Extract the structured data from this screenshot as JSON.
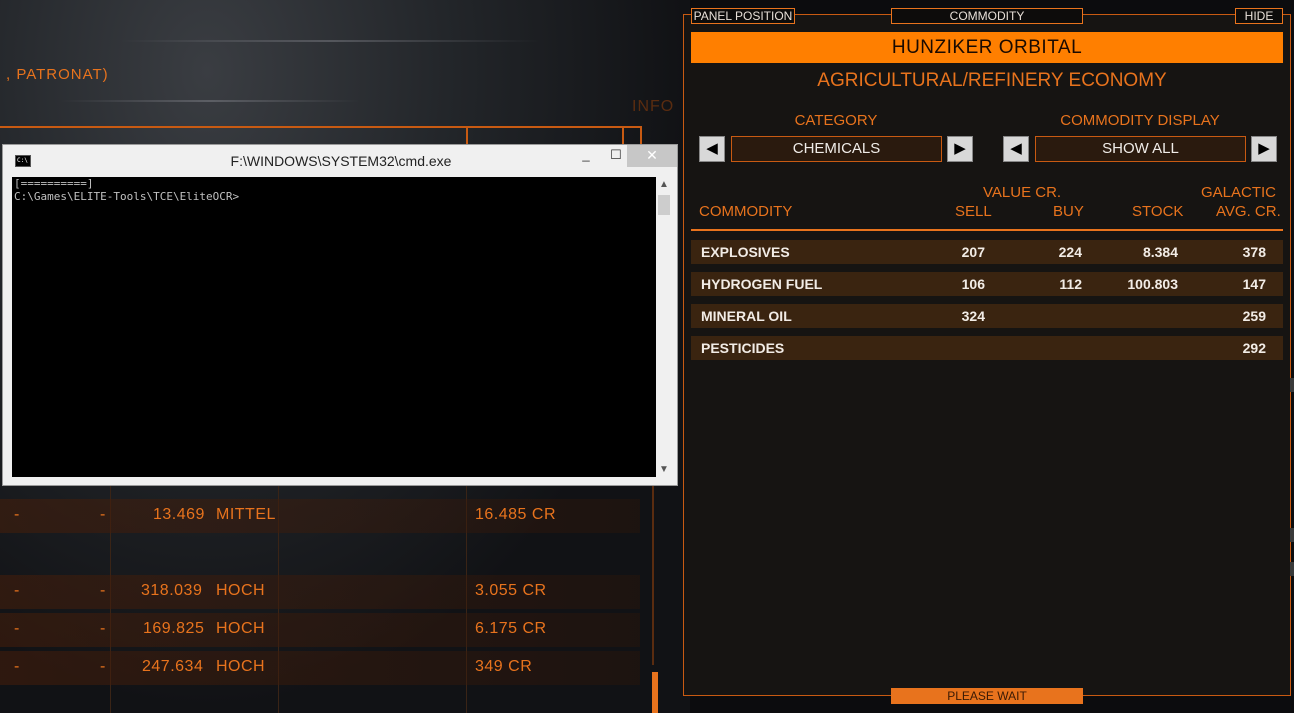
{
  "game_background": {
    "faction_fragment": ", PATRONAT)",
    "info_fragment": "INFO",
    "rows": [
      {
        "c1": "-",
        "c2": "-",
        "supply": "13.469",
        "level": "MITTEL",
        "price": "16.485 CR"
      },
      {
        "c1": "-",
        "c2": "-",
        "supply": "318.039",
        "level": "HOCH",
        "price": "3.055 CR"
      },
      {
        "c1": "-",
        "c2": "-",
        "supply": "169.825",
        "level": "HOCH",
        "price": "6.175 CR"
      },
      {
        "c1": "-",
        "c2": "-",
        "supply": "247.634",
        "level": "HOCH",
        "price": "349 CR"
      }
    ]
  },
  "console": {
    "title": "F:\\WINDOWS\\SYSTEM32\\cmd.exe",
    "icon_label": "C:\\",
    "minimize": "_",
    "maximize": "☐",
    "close": "✕",
    "line1": "[==========]",
    "line2": "C:\\Games\\ELITE-Tools\\TCE\\EliteOCR>"
  },
  "panel": {
    "panel_position_tab": "PANEL POSITION",
    "commodity_tab": "COMMODITY",
    "hide_tab": "HIDE",
    "status": "PLEASE WAIT",
    "station_name": "HUNZIKER ORBITAL",
    "economy": "AGRICULTURAL/REFINERY ECONOMY",
    "category_label": "CATEGORY",
    "category_value": "CHEMICALS",
    "display_label": "COMMODITY DISPLAY",
    "display_value": "SHOW ALL",
    "prev_icon": "◀",
    "next_icon": "▶",
    "headers": {
      "commodity": "COMMODITY",
      "value_cr": "VALUE CR.",
      "sell": "SELL",
      "buy": "BUY",
      "stock": "STOCK",
      "galactic": "GALACTIC",
      "avg_cr": "AVG. CR."
    },
    "rows": [
      {
        "name": "EXPLOSIVES",
        "sell": "207",
        "buy": "224",
        "stock": "8.384",
        "avg": "378"
      },
      {
        "name": "HYDROGEN FUEL",
        "sell": "106",
        "buy": "112",
        "stock": "100.803",
        "avg": "147"
      },
      {
        "name": "MINERAL OIL",
        "sell": "324",
        "buy": "",
        "stock": "",
        "avg": "259"
      },
      {
        "name": "PESTICIDES",
        "sell": "",
        "buy": "",
        "stock": "",
        "avg": "292"
      }
    ]
  },
  "colors": {
    "accent": "#ff7f00",
    "text_light": "#f2ece6",
    "row_bg": "#3a2410"
  }
}
